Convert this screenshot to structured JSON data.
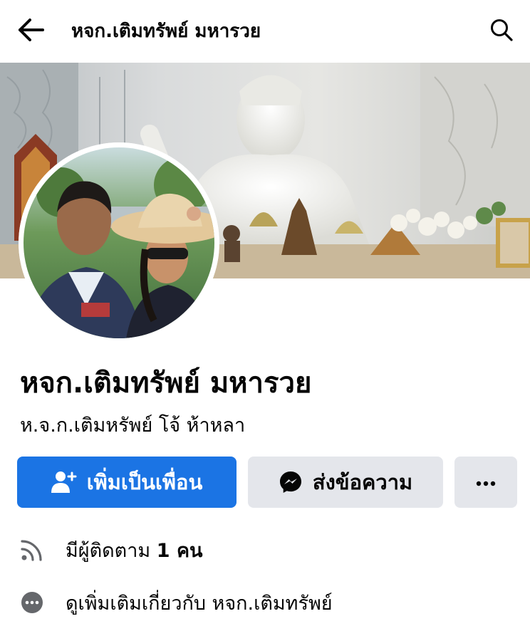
{
  "header": {
    "title": "หจก.เติมทรัพย์ มหารวย",
    "back_icon": "arrow-left-icon",
    "search_icon": "search-icon"
  },
  "profile": {
    "name": "หจก.เติมทรัพย์ มหารวย",
    "alternate_name": "ห.จ.ก.เติมหรัพย์ โจ้ ห้าหลา"
  },
  "actions": {
    "add_friend_label": "เพิ่มเป็นเพื่อน",
    "message_label": "ส่งข้อความ",
    "more_label": "···"
  },
  "info": {
    "followers_prefix": "มีผู้ติดตาม",
    "followers_count": "1 คน",
    "about_text": "ดูเพิ่มเติมเกี่ยวกับ หจก.เติมทรัพย์"
  },
  "colors": {
    "accent": "#1b74e4",
    "secondary_button": "#e4e6eb",
    "text": "#050505",
    "icon_gray": "#65676b"
  }
}
